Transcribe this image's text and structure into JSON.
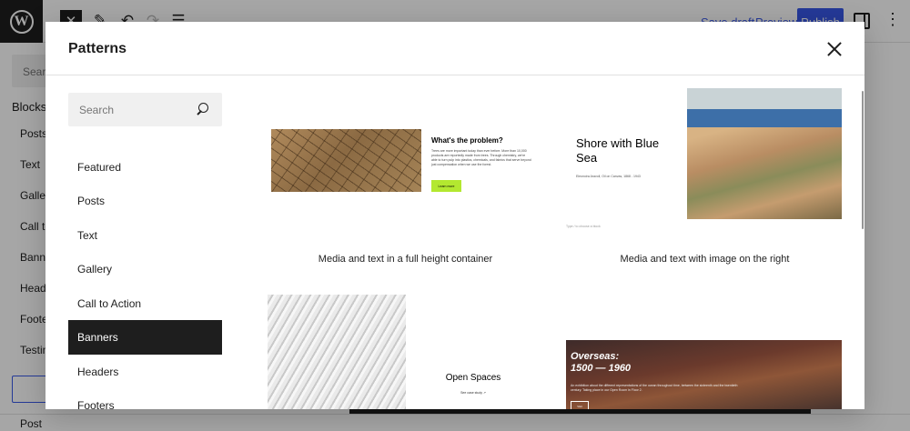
{
  "editor": {
    "top_links": [
      "Save draft",
      "Preview"
    ],
    "publish_label": "Publish",
    "inserter": {
      "search_placeholder": "Search",
      "tab_label": "Blocks",
      "categories": [
        "Posts",
        "Text",
        "Gallery",
        "Call to",
        "Banne",
        "Heade",
        "Footer",
        "Testim"
      ]
    },
    "footer_label": "Post"
  },
  "modal": {
    "title": "Patterns",
    "search": {
      "placeholder": "Search"
    },
    "categories": [
      {
        "label": "Featured",
        "active": false
      },
      {
        "label": "Posts",
        "active": false
      },
      {
        "label": "Text",
        "active": false
      },
      {
        "label": "Gallery",
        "active": false
      },
      {
        "label": "Call to Action",
        "active": false
      },
      {
        "label": "Banners",
        "active": true
      },
      {
        "label": "Headers",
        "active": false
      },
      {
        "label": "Footers",
        "active": false
      }
    ],
    "patterns": [
      {
        "caption": "Media and text in a full height container",
        "heading": "What's the problem?",
        "body": "Trees are more important today than ever before. More than 10,000 products are reportedly made from trees. Through chemistry, we're able to turn pulp into plastics, chemicals, and fabrics that serve beyond just compensation when we use the forest.",
        "button": "Learn more"
      },
      {
        "caption": "Media and text with image on the right",
        "title": "Shore with Blue Sea",
        "meta": "Eleonoira Aravoll, Oil on Canvas, 1868 - 1943",
        "hint": "Type / to choose a block"
      },
      {
        "caption": "",
        "title": "Open Spaces",
        "link": "See case study ↗"
      },
      {
        "caption": "",
        "title": "Overseas:\n1500 — 1960",
        "body": "An exhibition about the different representations of the ocean throughout time, between the sixteenth and the twentieth century. Taking place in our Open Room in Floor 2.",
        "button": "Visit"
      }
    ]
  }
}
